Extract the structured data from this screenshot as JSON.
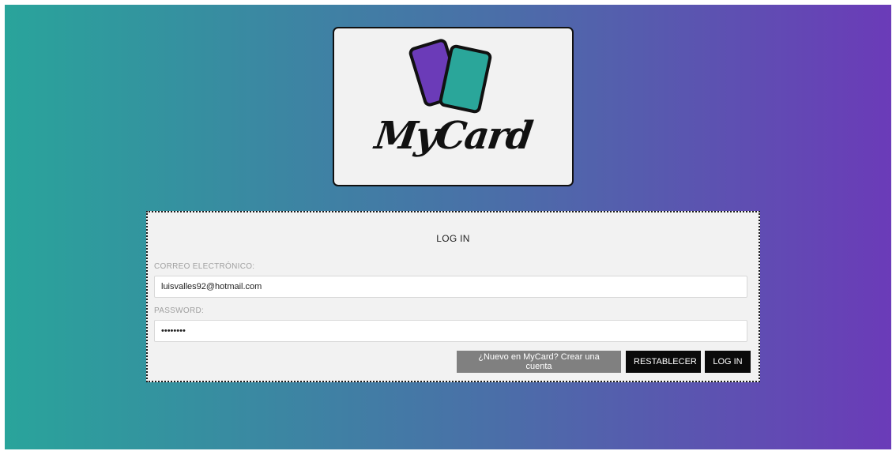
{
  "logo": {
    "brand_text": "MyCard",
    "card_back_color": "#6b3bb8",
    "card_front_color": "#2aa69a"
  },
  "login": {
    "title": "LOG IN",
    "email_label": "CORREO ELECTRÓNICO:",
    "email_value": "luisvalles92@hotmail.com",
    "password_label": "PASSWORD:",
    "password_value": "••••••••",
    "buttons": {
      "new_account": "¿Nuevo en MyCard? Crear una cuenta",
      "reset": "RESTABLECER",
      "login": "LOG IN"
    }
  }
}
